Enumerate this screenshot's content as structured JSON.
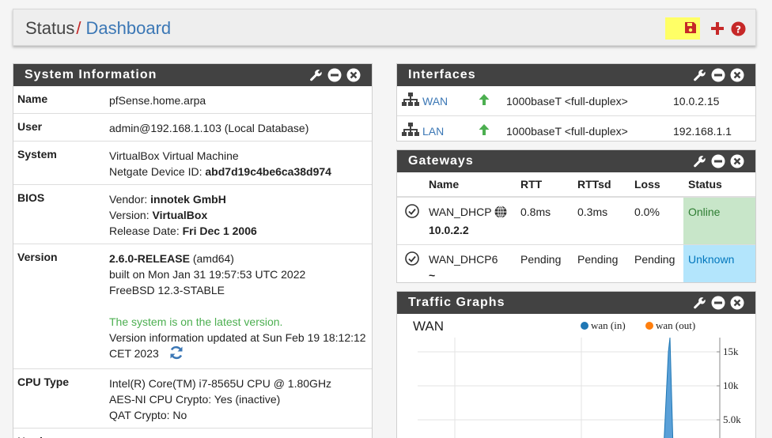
{
  "breadcrumb": {
    "parent": "Status",
    "separator": "/",
    "current": "Dashboard"
  },
  "system_info": {
    "title": "System Information",
    "name_label": "Name",
    "name_value": "pfSense.home.arpa",
    "user_label": "User",
    "user_value": "admin@192.168.1.103 (Local Database)",
    "system_label": "System",
    "system_line1": "VirtualBox Virtual Machine",
    "system_line2_prefix": "Netgate Device ID: ",
    "system_line2_value": "abd7d19c4be6ca38d974",
    "bios_label": "BIOS",
    "bios_vendor_prefix": "Vendor: ",
    "bios_vendor": "innotek GmbH",
    "bios_version_prefix": "Version: ",
    "bios_version": "VirtualBox",
    "bios_date_prefix": "Release Date: ",
    "bios_date": "Fri Dec 1 2006",
    "version_label": "Version",
    "version_release": "2.6.0-RELEASE",
    "version_arch": " (amd64)",
    "version_built": "built on Mon Jan 31 19:57:53 UTC 2022",
    "version_freebsd": "FreeBSD 12.3-STABLE",
    "version_status": "The system is on the latest version.",
    "version_updated": "Version information updated at Sun Feb 19 18:12:12 CET 2023",
    "cpu_label": "CPU Type",
    "cpu_line1": "Intel(R) Core(TM) i7-8565U CPU @ 1.80GHz",
    "cpu_line2": "AES-NI CPU Crypto: Yes (inactive)",
    "cpu_line3": "QAT Crypto: No",
    "hardware_label": "Hardware"
  },
  "interfaces": {
    "title": "Interfaces",
    "rows": [
      {
        "name": "WAN",
        "media": "1000baseT <full-duplex>",
        "ip": "10.0.2.15"
      },
      {
        "name": "LAN",
        "media": "1000baseT <full-duplex>",
        "ip": "192.168.1.1"
      }
    ]
  },
  "gateways": {
    "title": "Gateways",
    "headers": {
      "name": "Name",
      "rtt": "RTT",
      "rttsd": "RTTsd",
      "loss": "Loss",
      "status": "Status"
    },
    "rows": [
      {
        "name": "WAN_DHCP",
        "addr": "10.0.2.2",
        "rtt": "0.8ms",
        "rttsd": "0.3ms",
        "loss": "0.0%",
        "status": "Online"
      },
      {
        "name": "WAN_DHCP6",
        "addr": "~",
        "rtt": "Pending",
        "rttsd": "Pending",
        "loss": "Pending",
        "status": "Unknown"
      }
    ]
  },
  "traffic": {
    "title": "Traffic Graphs",
    "graph_label": "WAN",
    "legend_in": "wan (in)",
    "legend_out": "wan (out)",
    "ticks": [
      "15k",
      "10k",
      "5.0k"
    ],
    "colors": {
      "in": "#1f77b4",
      "out": "#ff7f0e"
    }
  },
  "colors": {
    "titlebar": "#424242",
    "accent": "#3b77b5",
    "danger": "#c62828",
    "success": "#4caf50",
    "save_highlight": "#ffff66"
  },
  "icons": [
    "save-icon",
    "plus-icon",
    "help-icon",
    "wrench-icon",
    "minus-circle-icon",
    "close-circle-icon",
    "network-icon",
    "arrow-up-icon",
    "check-circle-icon",
    "globe-icon",
    "refresh-icon"
  ]
}
